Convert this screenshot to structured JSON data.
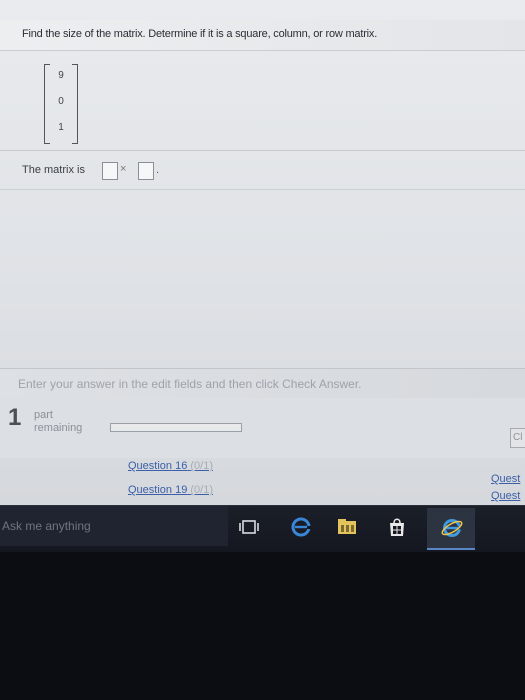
{
  "question": {
    "prompt": "Find the size of the matrix. Determine if it is a square, column, or row matrix."
  },
  "matrix": {
    "entries": [
      "9",
      "0",
      "1"
    ]
  },
  "answer": {
    "prefix": "The matrix is",
    "rows_value": "",
    "columns_value": "",
    "times": "×",
    "period": "."
  },
  "instruction": {
    "text": "Enter your answer in the edit fields and then click Check Answer."
  },
  "parts": {
    "count": "1",
    "label_line1": "part",
    "label_line2": "remaining",
    "progress": 0,
    "check_button_fragment": "Cl"
  },
  "navigation": {
    "left_links": [
      {
        "label": "Question 16",
        "score": "(0/1)"
      },
      {
        "label": "Question 19",
        "score": "(0/1)"
      }
    ],
    "right_links": [
      "Quest",
      "Quest"
    ]
  },
  "taskbar": {
    "search_placeholder": "Ask me anything",
    "icons": [
      "task-view-icon",
      "edge-icon",
      "file-explorer-icon",
      "store-icon",
      "internet-explorer-icon"
    ]
  },
  "colors": {
    "link": "#3c5fa8",
    "taskbar": "#141720",
    "active_underline": "#5c87c7"
  }
}
